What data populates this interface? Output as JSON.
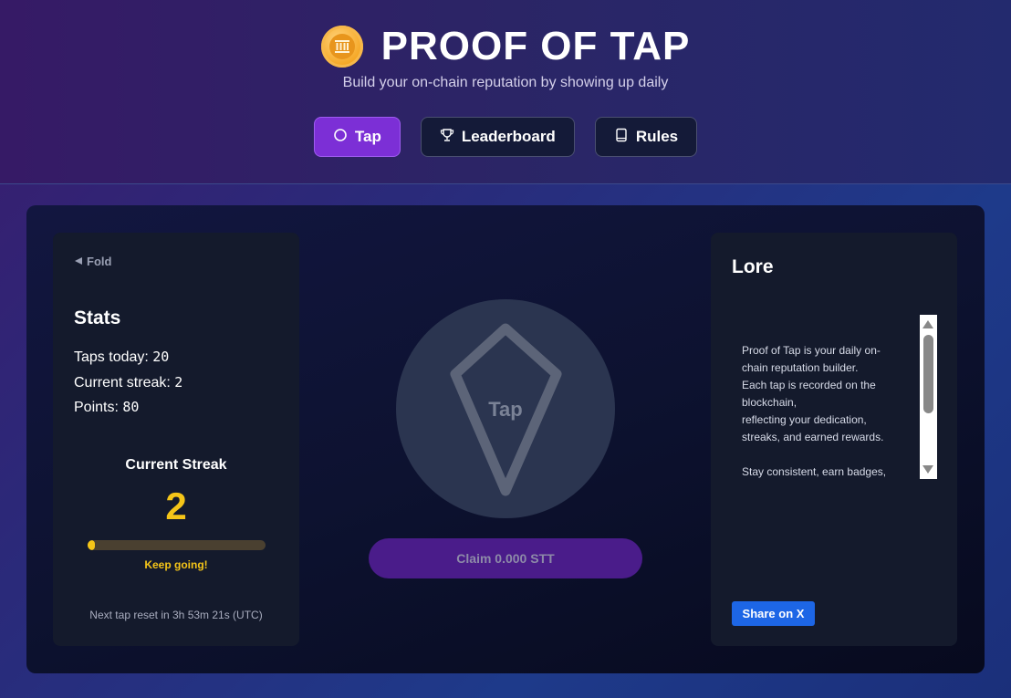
{
  "header": {
    "title": "PROOF OF TAP",
    "subtitle": "Build your on-chain reputation by showing up daily",
    "logo_icon": "coin-icon"
  },
  "nav": {
    "tabs": [
      {
        "label": "Tap",
        "icon": "circle-icon",
        "active": true
      },
      {
        "label": "Leaderboard",
        "icon": "trophy-icon",
        "active": false
      },
      {
        "label": "Rules",
        "icon": "book-icon",
        "active": false
      }
    ]
  },
  "stats": {
    "fold_label": "Fold",
    "title": "Stats",
    "taps_label": "Taps today:",
    "taps_value": "20",
    "streak_label": "Current streak:",
    "streak_value": "2",
    "points_label": "Points:",
    "points_value": "80",
    "current_streak_title": "Current Streak",
    "current_streak_number": "2",
    "streak_progress": 0.02,
    "keep_going": "Keep going!",
    "reset_text": "Next tap reset in 3h 53m 21s (UTC)"
  },
  "tap": {
    "label": "Tap",
    "claim_label": "Claim 0.000 STT"
  },
  "lore": {
    "title": "Lore",
    "text": "Proof of Tap is your daily on-chain reputation builder.\nEach tap is recorded on the blockchain,\nreflecting your dedication, streaks, and earned rewards.\n\nStay consistent, earn badges,",
    "share_label": "Share on X"
  },
  "colors": {
    "accent": "#7c2fd6",
    "streak": "#f5c518",
    "share": "#1d66e6"
  }
}
